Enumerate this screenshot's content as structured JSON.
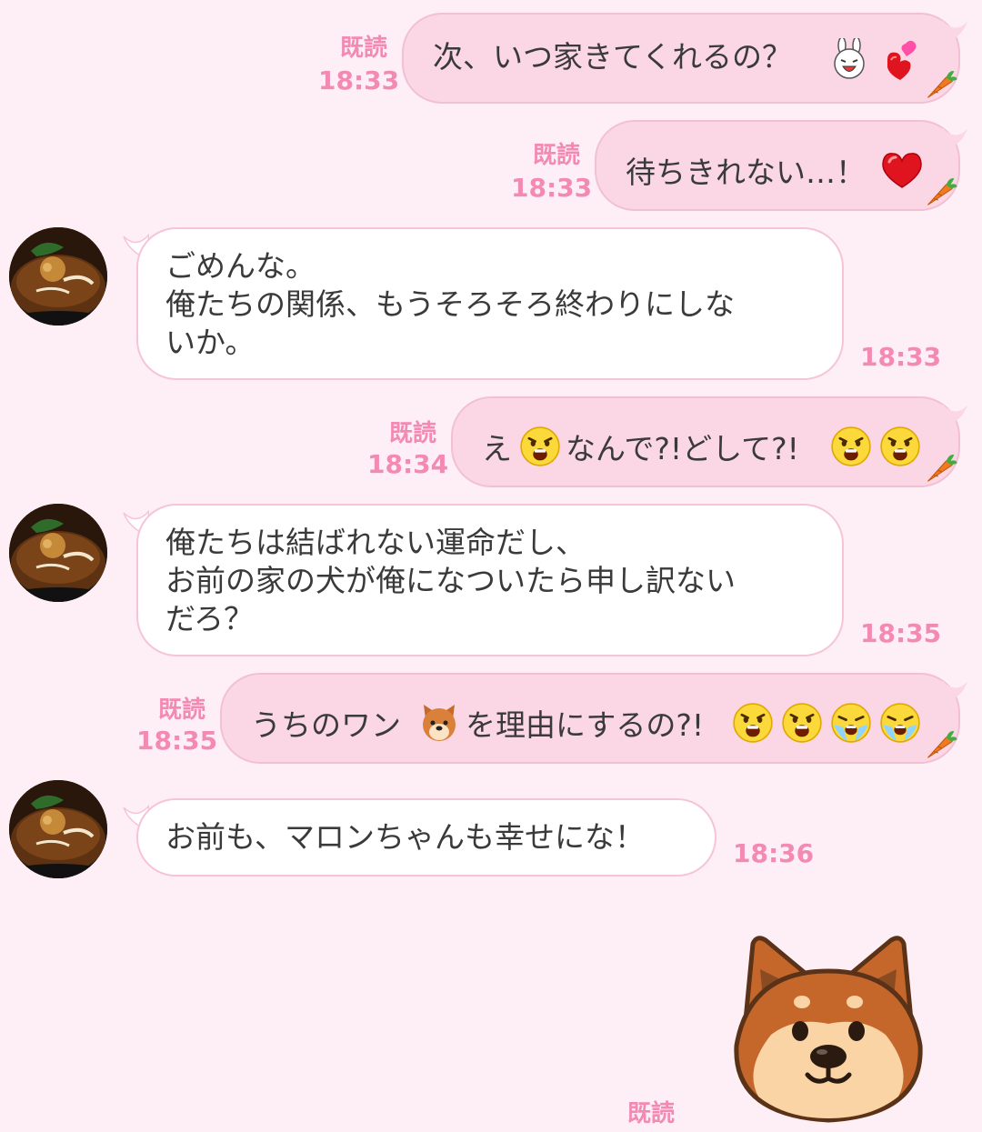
{
  "chat": {
    "messages": [
      {
        "side": "out",
        "text": "次、いつ家きてくれるの？",
        "read": "既読",
        "time": "18:33",
        "emojis": [
          "rabbit-face-emoji",
          "pink-heart-emoji"
        ]
      },
      {
        "side": "out",
        "text": "待ちきれない…！",
        "read": "既読",
        "time": "18:33",
        "emojis": [
          "red-heart-emoji"
        ]
      },
      {
        "side": "in",
        "text": "ごめんな。\n俺たちの関係、もうそろそろ終わりにしな\nいか。",
        "time": "18:33"
      },
      {
        "side": "out",
        "text_a": "え",
        "text_b": "なんで?!どして?!",
        "read": "既読",
        "time": "18:34",
        "emojis": [
          "screaming-face-emoji",
          "screaming-face-emoji",
          "screaming-face-emoji"
        ]
      },
      {
        "side": "in",
        "text": "俺たちは結ばれない運命だし、\nお前の家の犬が俺になついたら申し訳ない\nだろ？",
        "time": "18:35"
      },
      {
        "side": "out",
        "text_a": "うちのワン",
        "text_b": "を理由にするの?!",
        "read": "既読",
        "time": "18:35",
        "emojis": [
          "dog-face-emoji",
          "screaming-face-emoji",
          "screaming-face-emoji",
          "crying-face-emoji",
          "crying-face-emoji"
        ]
      },
      {
        "side": "in",
        "text": "お前も、マロンちゃんも幸せにな！",
        "time": "18:36"
      }
    ],
    "last_read": "既読",
    "sticker": "shiba-dog-sticker",
    "colors": {
      "background": "#fdeff5",
      "outgoing_bubble": "#fbd7e6",
      "incoming_bubble": "#ffffff",
      "read_text": "#f28ab1"
    }
  }
}
